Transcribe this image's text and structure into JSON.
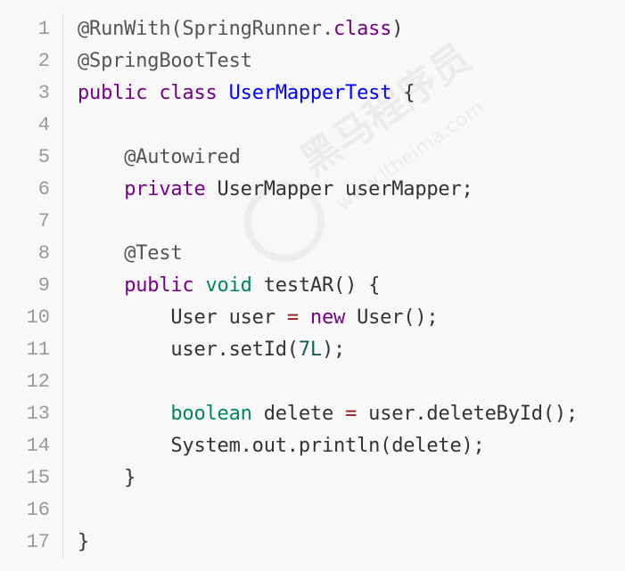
{
  "watermark": {
    "cn_text": "黑马程序员",
    "url_text": "www.itheima.com"
  },
  "code": {
    "lines": [
      {
        "num": "1",
        "tokens": [
          {
            "t": "@RunWith(SpringRunner.",
            "c": "ann"
          },
          {
            "t": "class",
            "c": "kw"
          },
          {
            "t": ")",
            "c": "plain"
          }
        ]
      },
      {
        "num": "2",
        "tokens": [
          {
            "t": "@SpringBootTest",
            "c": "ann"
          }
        ]
      },
      {
        "num": "3",
        "tokens": [
          {
            "t": "public",
            "c": "kw"
          },
          {
            "t": " ",
            "c": "plain"
          },
          {
            "t": "class",
            "c": "kw"
          },
          {
            "t": " ",
            "c": "plain"
          },
          {
            "t": "UserMapperTest",
            "c": "def"
          },
          {
            "t": " {",
            "c": "plain"
          }
        ]
      },
      {
        "num": "4",
        "tokens": []
      },
      {
        "num": "5",
        "tokens": [
          {
            "t": "    ",
            "c": "plain"
          },
          {
            "t": "@Autowired",
            "c": "ann"
          }
        ]
      },
      {
        "num": "6",
        "tokens": [
          {
            "t": "    ",
            "c": "plain"
          },
          {
            "t": "private",
            "c": "kw"
          },
          {
            "t": " UserMapper userMapper;",
            "c": "plain"
          }
        ]
      },
      {
        "num": "7",
        "tokens": []
      },
      {
        "num": "8",
        "tokens": [
          {
            "t": "    ",
            "c": "plain"
          },
          {
            "t": "@Test",
            "c": "ann"
          }
        ]
      },
      {
        "num": "9",
        "tokens": [
          {
            "t": "    ",
            "c": "plain"
          },
          {
            "t": "public",
            "c": "kw"
          },
          {
            "t": " ",
            "c": "plain"
          },
          {
            "t": "void",
            "c": "type"
          },
          {
            "t": " testAR() {",
            "c": "plain"
          }
        ]
      },
      {
        "num": "10",
        "tokens": [
          {
            "t": "        User user ",
            "c": "plain"
          },
          {
            "t": "=",
            "c": "op"
          },
          {
            "t": " ",
            "c": "plain"
          },
          {
            "t": "new",
            "c": "kw"
          },
          {
            "t": " User();",
            "c": "plain"
          }
        ]
      },
      {
        "num": "11",
        "tokens": [
          {
            "t": "        user.setId(",
            "c": "plain"
          },
          {
            "t": "7L",
            "c": "num"
          },
          {
            "t": ");",
            "c": "plain"
          }
        ]
      },
      {
        "num": "12",
        "tokens": []
      },
      {
        "num": "13",
        "tokens": [
          {
            "t": "        ",
            "c": "plain"
          },
          {
            "t": "boolean",
            "c": "type"
          },
          {
            "t": " delete ",
            "c": "plain"
          },
          {
            "t": "=",
            "c": "op"
          },
          {
            "t": " user.deleteById();",
            "c": "plain"
          }
        ]
      },
      {
        "num": "14",
        "tokens": [
          {
            "t": "        System.out.println(delete);",
            "c": "plain"
          }
        ]
      },
      {
        "num": "15",
        "tokens": [
          {
            "t": "    }",
            "c": "plain"
          }
        ]
      },
      {
        "num": "16",
        "tokens": []
      },
      {
        "num": "17",
        "tokens": [
          {
            "t": "}",
            "c": "plain"
          }
        ]
      }
    ]
  },
  "colors": {
    "background": "#f8f8f8",
    "line_number": "#999999",
    "annotation": "#555555",
    "keyword": "#770088",
    "type": "#008855",
    "definition": "#0000ff",
    "number": "#116644",
    "operator": "#981a1a",
    "plain": "#333333"
  }
}
